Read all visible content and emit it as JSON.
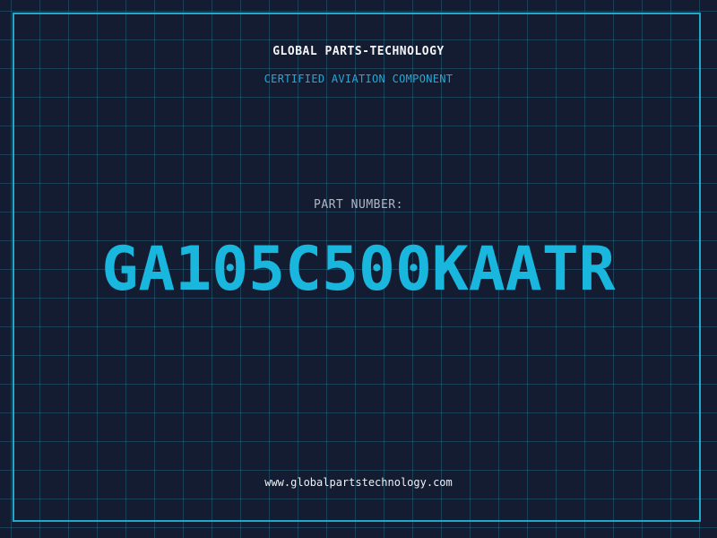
{
  "card": {
    "brand": "GLOBAL PARTS-TECHNOLOGY",
    "subtitle": "CERTIFIED AVIATION COMPONENT",
    "part_label": "PART NUMBER:",
    "part_number": "GA105C500KAATR",
    "url": "www.globalpartstechnology.com"
  },
  "colors": {
    "background": "#131c30",
    "grid": "#286e8c",
    "accent": "#19b7dd",
    "frame": "#1ea9c8"
  }
}
